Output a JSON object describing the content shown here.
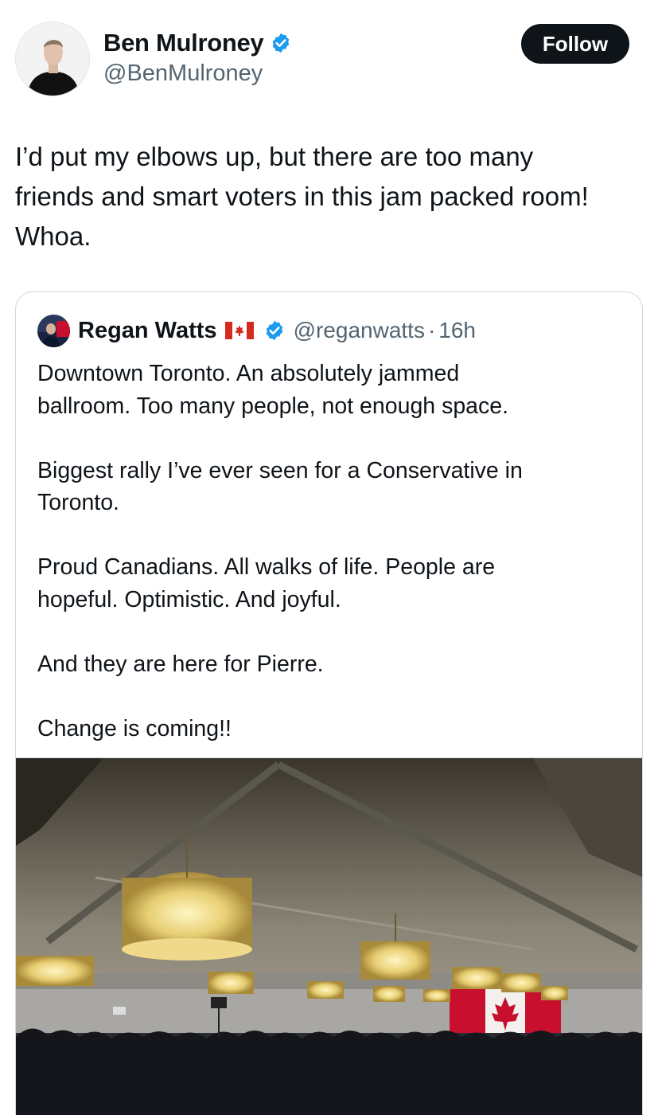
{
  "author": {
    "display_name": "Ben Mulroney",
    "handle": "@BenMulroney",
    "verified": true
  },
  "follow_button": {
    "label": "Follow"
  },
  "tweet": {
    "lines": [
      "I’d put my elbows up, but there are too many",
      "friends and smart voters in this jam packed room!",
      "Whoa."
    ]
  },
  "quote": {
    "author_name": "Regan Watts",
    "flag": "canada-flag-icon",
    "verified": true,
    "handle": "@reganwatts",
    "separator": "·",
    "time": "16h",
    "paragraphs": [
      [
        "Downtown Toronto. An absolutely jammed",
        "ballroom. Too many people, not enough space."
      ],
      [
        "Biggest rally I’ve ever seen for a Conservative in",
        "Toronto."
      ],
      [
        "Proud Canadians. All walks of life. People are",
        "hopeful. Optimistic. And joyful."
      ],
      [
        "And they are here for Pierre."
      ],
      [
        "Change is coming!!"
      ]
    ],
    "media": {
      "kind": "photo",
      "icon": "ballroom-rally-photo"
    }
  },
  "colors": {
    "text": "#0f1419",
    "secondary": "#536471",
    "verified_blue": "#1d9bf0",
    "button_bg": "#0f1419",
    "border": "#cfd9de",
    "flag_red": "#d52b1e"
  }
}
